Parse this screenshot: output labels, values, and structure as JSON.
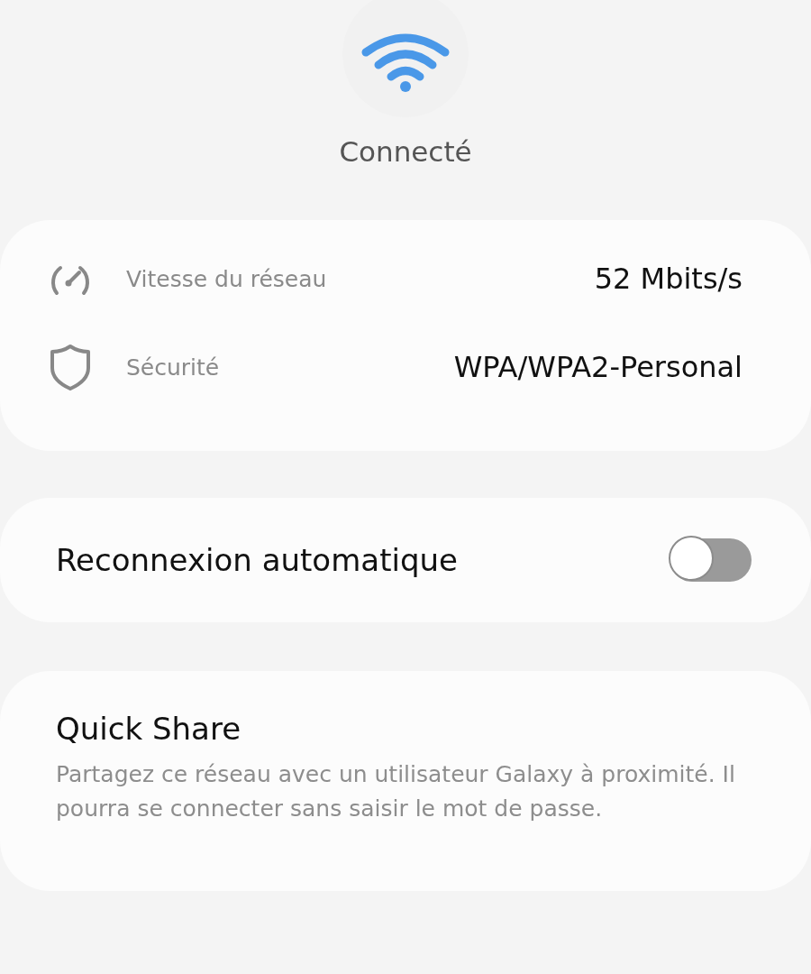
{
  "status": "Connecté",
  "details": [
    {
      "kind": "speed",
      "label": "Vitesse du réseau",
      "value": "52 Mbits/s"
    },
    {
      "kind": "security",
      "label": "Sécurité",
      "value": "WPA/WPA2-Personal"
    }
  ],
  "auto_reconnect": {
    "label": "Reconnexion automatique",
    "on": false
  },
  "quick_share": {
    "title": "Quick Share",
    "description": "Partagez ce réseau avec un utilisateur Galaxy à proximité. Il pourra se connecter sans saisir le mot de passe."
  }
}
